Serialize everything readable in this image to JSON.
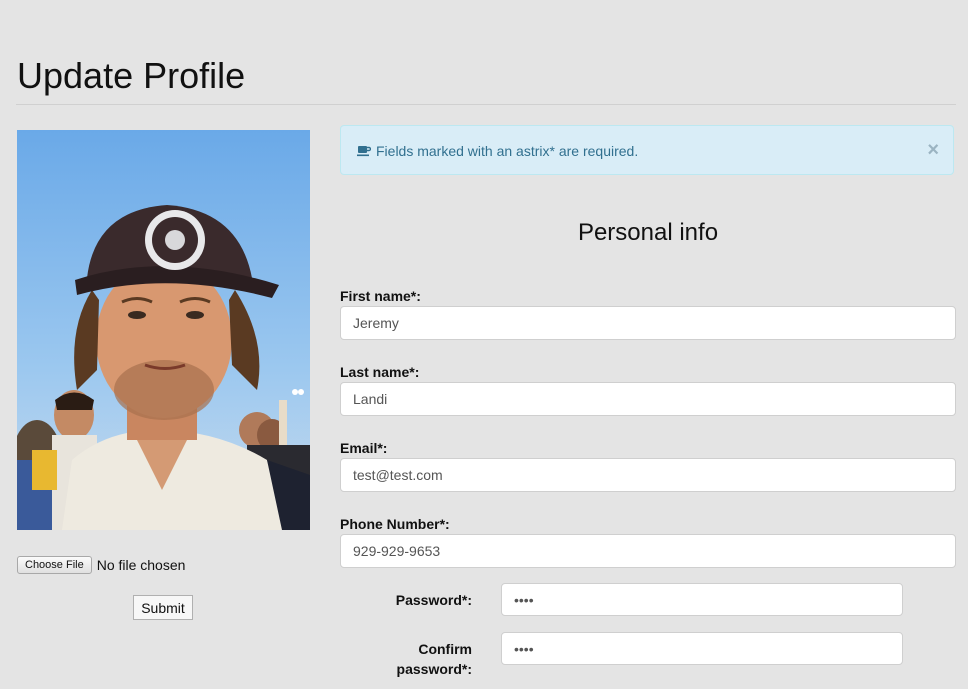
{
  "page": {
    "title": "Update Profile"
  },
  "profile": {
    "photo_icon": "profile-photo",
    "choose_file_label": "Choose File",
    "file_status": "No file chosen",
    "submit_label": "Submit"
  },
  "alert": {
    "icon": "coffee-icon",
    "text": "Fields marked with an astrix* are required.",
    "close": "×",
    "bg_color": "#d9edf7",
    "text_color": "#31708f"
  },
  "form": {
    "section_title": "Personal info",
    "first_name": {
      "label": "First name*:",
      "value": "Jeremy"
    },
    "last_name": {
      "label": "Last name*:",
      "value": "Landi"
    },
    "email": {
      "label": "Email*:",
      "value": "test@test.com"
    },
    "phone": {
      "label": "Phone Number*:",
      "value": "929-929-9653"
    },
    "password": {
      "label": "Password*:",
      "value": "••••"
    },
    "confirm_password": {
      "label_line1": "Confirm",
      "label_line2": "password*:",
      "value": "••••"
    }
  }
}
